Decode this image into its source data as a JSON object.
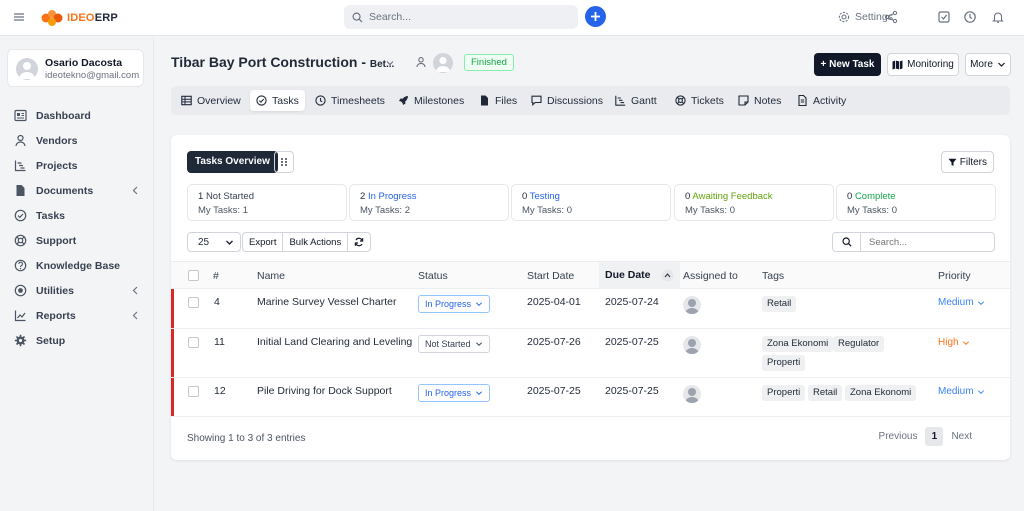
{
  "brand": {
    "logo_text_a": "IDEO",
    "logo_text_b": "ERP"
  },
  "topbar": {
    "search_placeholder": "Search...",
    "settings_label": "Settings"
  },
  "profile": {
    "name": "Osario Dacosta",
    "email": "ideotekno@gmail.com"
  },
  "sidebar": {
    "items": [
      {
        "label": "Dashboard",
        "icon": "dashboard-icon",
        "has_submenu": false
      },
      {
        "label": "Vendors",
        "icon": "user-icon",
        "has_submenu": false
      },
      {
        "label": "Projects",
        "icon": "projects-icon",
        "has_submenu": false
      },
      {
        "label": "Documents",
        "icon": "document-icon",
        "has_submenu": true
      },
      {
        "label": "Tasks",
        "icon": "check-circle-icon",
        "has_submenu": false
      },
      {
        "label": "Support",
        "icon": "lifebuoy-icon",
        "has_submenu": false
      },
      {
        "label": "Knowledge Base",
        "icon": "question-circle-icon",
        "has_submenu": false
      },
      {
        "label": "Utilities",
        "icon": "radio-icon",
        "has_submenu": true
      },
      {
        "label": "Reports",
        "icon": "chart-line-icon",
        "has_submenu": true
      },
      {
        "label": "Setup",
        "icon": "cog-icon",
        "has_submenu": false
      }
    ]
  },
  "project": {
    "title": "Tibar Bay Port Construction - ",
    "title_suffix": "Bet...",
    "status_badge": "Finished",
    "new_task_label": "+ New Task",
    "monitoring_label": "Monitoring",
    "more_label": "More"
  },
  "tabs": [
    {
      "label": "Overview",
      "icon": "table-icon",
      "active": false
    },
    {
      "label": "Tasks",
      "icon": "check-circle-icon",
      "active": true
    },
    {
      "label": "Timesheets",
      "icon": "clock-icon",
      "active": false
    },
    {
      "label": "Milestones",
      "icon": "rocket-icon",
      "active": false
    },
    {
      "label": "Files",
      "icon": "file-icon",
      "active": false
    },
    {
      "label": "Discussions",
      "icon": "chat-icon",
      "active": false
    },
    {
      "label": "Gantt",
      "icon": "gantt-icon",
      "active": false
    },
    {
      "label": "Tickets",
      "icon": "lifebuoy-icon",
      "active": false
    },
    {
      "label": "Notes",
      "icon": "note-icon",
      "active": false
    },
    {
      "label": "Activity",
      "icon": "activity-icon",
      "active": false
    }
  ],
  "tasks_panel": {
    "overview_label": "Tasks Overview",
    "filters_label": "Filters",
    "summary": [
      {
        "count": "1",
        "label": "Not Started",
        "mine": "My Tasks: 1",
        "color": "#374151"
      },
      {
        "count": "2",
        "label": "In Progress",
        "mine": "My Tasks: 2",
        "color": "#2563eb"
      },
      {
        "count": "0",
        "label": "Testing",
        "mine": "My Tasks: 0",
        "color": "#2563eb"
      },
      {
        "count": "0",
        "label": "Awaiting Feedback",
        "mine": "My Tasks: 0",
        "color": "#65a30d"
      },
      {
        "count": "0",
        "label": "Complete",
        "mine": "My Tasks: 0",
        "color": "#16a34a"
      }
    ],
    "per_page": "25",
    "export_label": "Export",
    "bulk_label": "Bulk Actions",
    "search_placeholder": "Search...",
    "columns": [
      "#",
      "Name",
      "Status",
      "Start Date",
      "Due Date",
      "Assigned to",
      "Tags",
      "Priority"
    ],
    "rows": [
      {
        "id": "4",
        "name": "Marine Survey Vessel Charter",
        "status": "In Progress",
        "start": "2025-04-01",
        "due": "2025-07-24",
        "tags": [
          "Retail"
        ],
        "priority": "Medium",
        "priority_color": "#3b82f6"
      },
      {
        "id": "11",
        "name": "Initial Land Clearing and Leveling",
        "status": "Not Started",
        "start": "2025-07-26",
        "due": "2025-07-25",
        "tags": [
          "Zona Ekonomi",
          "Regulator",
          "Properti"
        ],
        "priority": "High",
        "priority_color": "#f97316"
      },
      {
        "id": "12",
        "name": "Pile Driving for Dock Support",
        "status": "In Progress",
        "start": "2025-07-25",
        "due": "2025-07-25",
        "tags": [
          "Properti",
          "Retail",
          "Zona Ekonomi"
        ],
        "priority": "Medium",
        "priority_color": "#3b82f6"
      }
    ],
    "footer_info": "Showing 1 to 3 of 3 entries",
    "pager": {
      "previous": "Previous",
      "current": "1",
      "next": "Next"
    }
  },
  "colors": {
    "accent": "#2563eb",
    "danger_edge": "#dc2626",
    "dark_button": "#111827",
    "logo_orange": "#f97316"
  }
}
